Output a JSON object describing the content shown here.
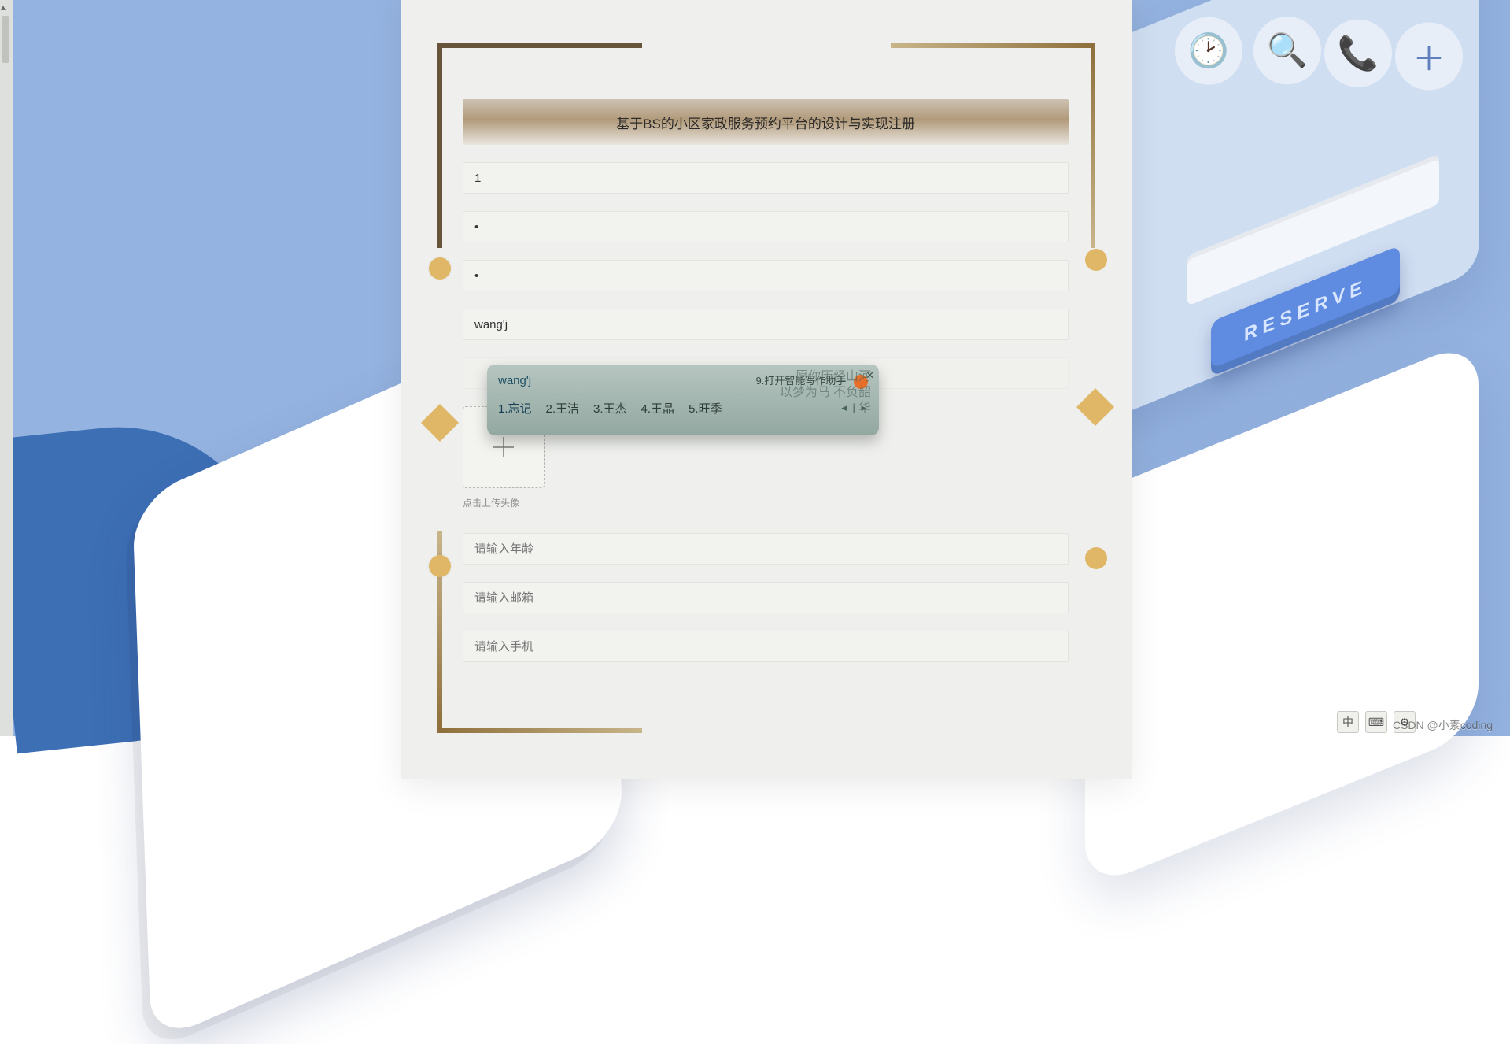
{
  "page": {
    "title": "基于BS的小区家政服务预约平台的设计与实现注册"
  },
  "form": {
    "field1_value": "1",
    "field2_value_display": "•",
    "field3_value_display": "•",
    "field4_value": "wang'j",
    "upload_hint": "点击上传头像",
    "age_placeholder": "请输入年龄",
    "email_placeholder": "请输入邮箱",
    "phone_placeholder": "请输入手机"
  },
  "ime": {
    "pinyin": "wang'j",
    "assist_label": "9.打开智能写作助手",
    "candidates": [
      "1.忘记",
      "2.王洁",
      "3.王杰",
      "4.王晶",
      "5.旺季"
    ],
    "pager": "◂ | ▸",
    "promo_line1": "愿你历经山河",
    "promo_line2": "以梦为马 不负韶华"
  },
  "background": {
    "reserve_button_label": "RESERVE"
  },
  "taskbar": {
    "ime_indicator": "中"
  },
  "watermark": "CSDN @小素coding"
}
